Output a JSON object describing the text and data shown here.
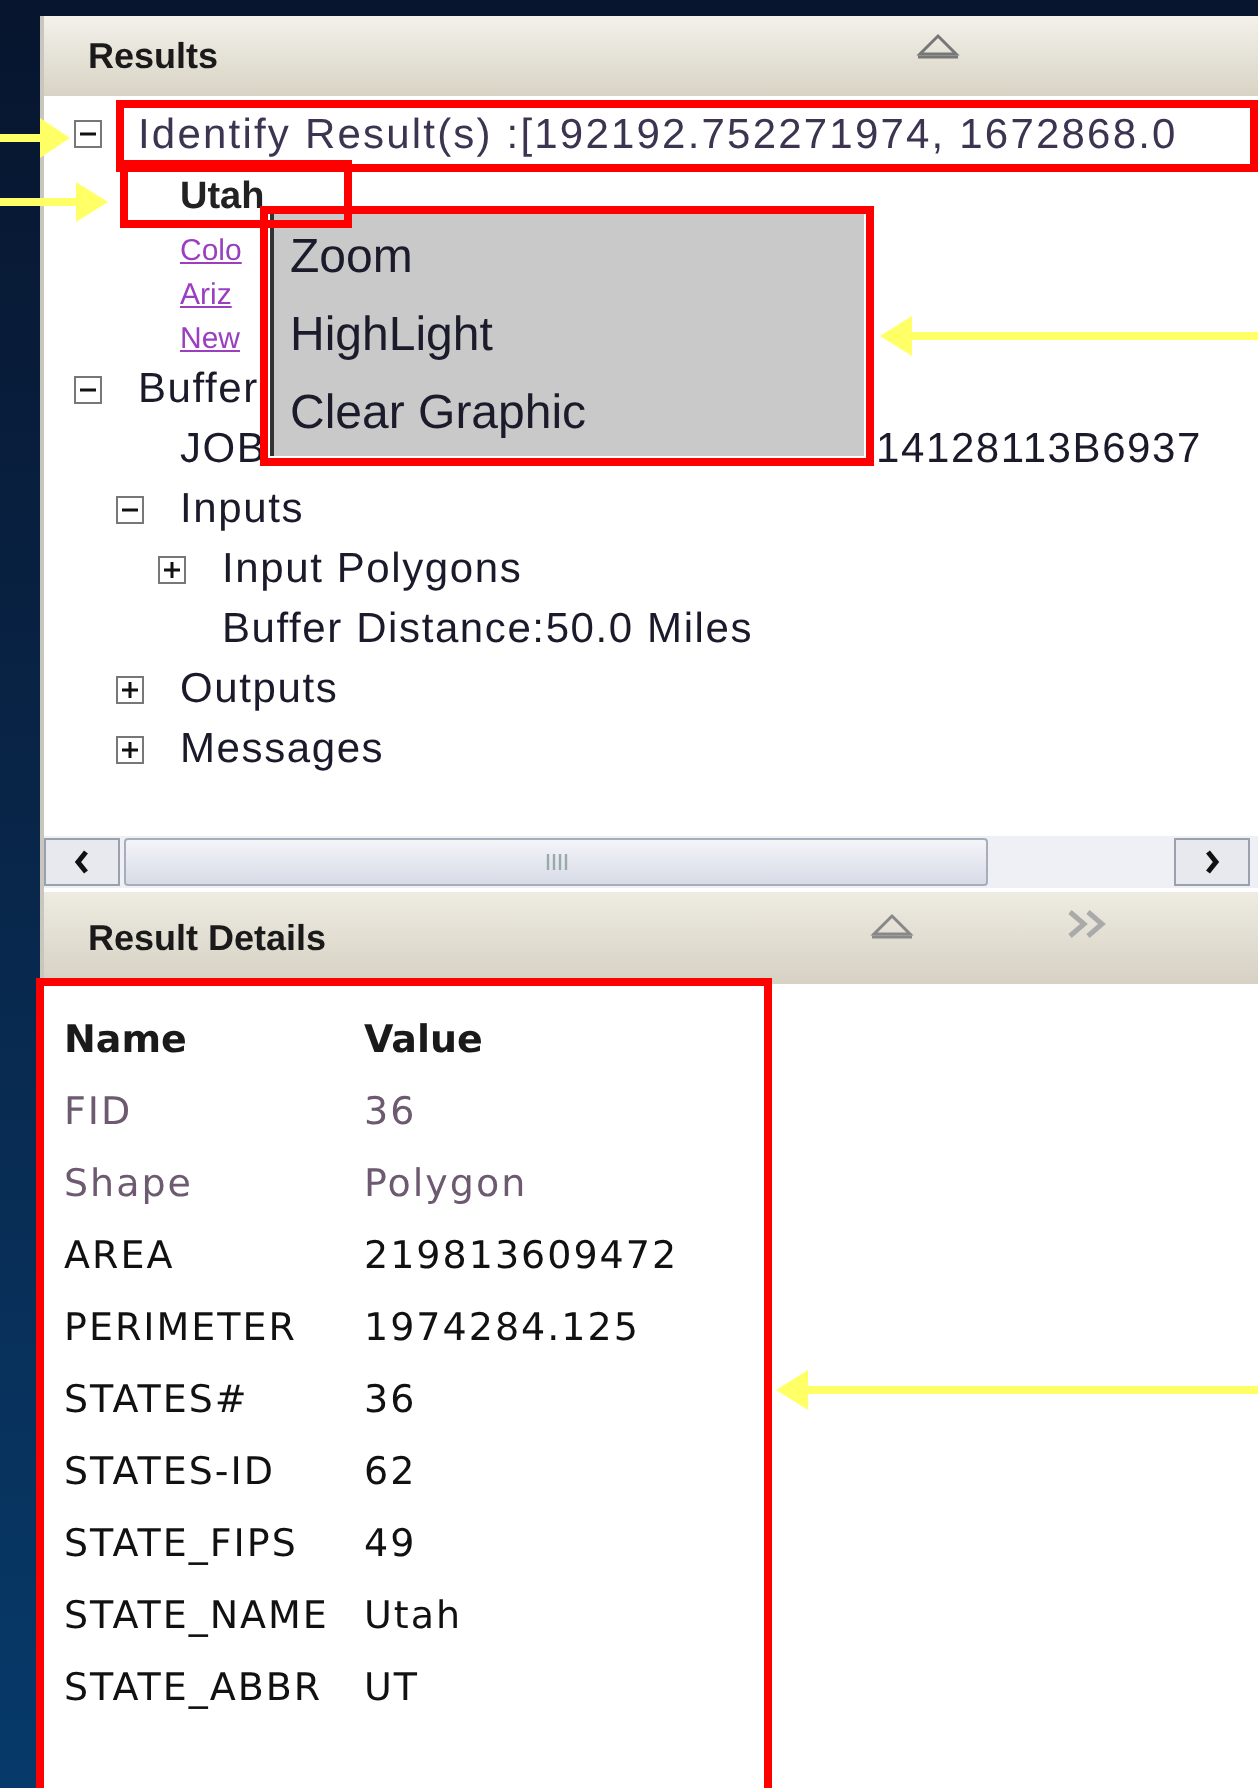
{
  "results_panel": {
    "title": "Results",
    "tree": [
      {
        "label": "Identify Result(s) :[192192.752271974, 1672868.0",
        "expanded": true,
        "children": [
          {
            "label": "Utah",
            "kind": "bold"
          },
          {
            "label": "Colo",
            "kind": "link"
          },
          {
            "label": "Ariz",
            "kind": "link"
          },
          {
            "label": "New",
            "kind": "link"
          }
        ]
      },
      {
        "label": "Buffer",
        "expanded": true,
        "children": [
          {
            "kind": "split",
            "label": "JOB",
            "label_end": "14128113B6937"
          },
          {
            "label": "Inputs",
            "expanded": true,
            "children": [
              {
                "label": "Input Polygons",
                "expanded": false
              },
              {
                "label": "Buffer Distance:50.0 Miles"
              }
            ]
          },
          {
            "label": "Outputs",
            "expanded": false
          },
          {
            "label": "Messages",
            "expanded": false
          }
        ]
      }
    ],
    "context_menu": [
      "Zoom",
      "HighLight",
      "Clear Graphic"
    ]
  },
  "details_panel": {
    "title": "Result Details",
    "columns": [
      "Name",
      "Value"
    ],
    "rows": [
      {
        "name": "FID",
        "value": "36",
        "dimmed": true
      },
      {
        "name": "Shape",
        "value": "Polygon",
        "dimmed": true
      },
      {
        "name": "AREA",
        "value": "219813609472",
        "dimmed": false
      },
      {
        "name": "PERIMETER",
        "value": "1974284.125",
        "dimmed": false
      },
      {
        "name": "STATES#",
        "value": "36",
        "dimmed": false
      },
      {
        "name": "STATES-ID",
        "value": "62",
        "dimmed": false
      },
      {
        "name": "STATE_FIPS",
        "value": "49",
        "dimmed": false
      },
      {
        "name": "STATE_NAME",
        "value": "Utah",
        "dimmed": false
      },
      {
        "name": "STATE_ABBR",
        "value": "UT",
        "dimmed": false
      }
    ]
  }
}
